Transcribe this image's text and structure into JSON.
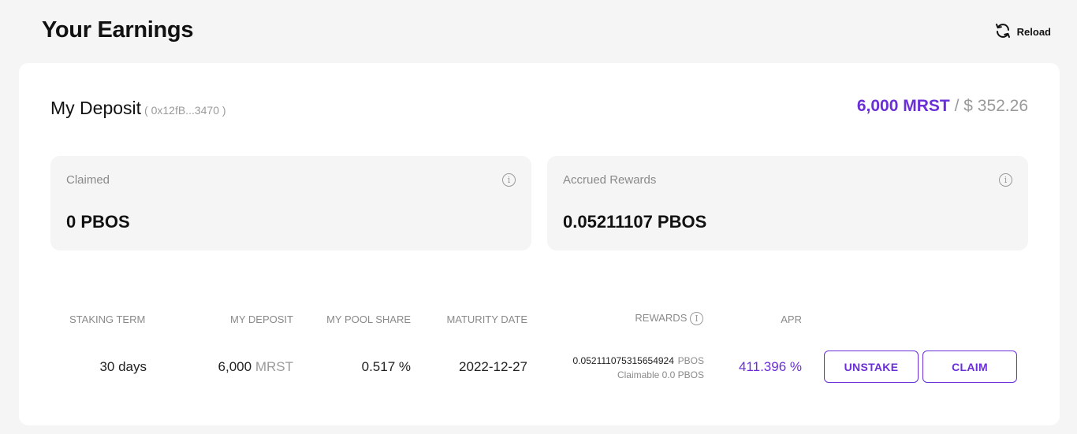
{
  "header": {
    "title": "Your Earnings",
    "reload_label": "Reload"
  },
  "deposit": {
    "heading": "My Deposit",
    "address": "( 0x12fB...3470 )",
    "amount": "6,000 MRST",
    "separator": " / ",
    "usd_value": "$ 352.26"
  },
  "stats": [
    {
      "label": "Claimed",
      "value": "0 PBOS"
    },
    {
      "label": "Accrued Rewards",
      "value": "0.05211107 PBOS"
    }
  ],
  "table": {
    "headers": {
      "staking_term": "STAKING TERM",
      "my_deposit": "MY DEPOSIT",
      "my_pool_share": "MY POOL SHARE",
      "maturity_date": "MATURITY DATE",
      "rewards": "REWARDS",
      "apr": "APR"
    },
    "row": {
      "staking_term": "30 days",
      "deposit_amount": "6,000",
      "deposit_token": "MRST",
      "pool_share": "0.517 %",
      "maturity_date": "2022-12-27",
      "rewards_amount": "0.052111075315654924",
      "rewards_token": "PBOS",
      "rewards_claimable": "Claimable 0.0 PBOS",
      "apr": "411.396 %",
      "unstake_label": "UNSTAKE",
      "claim_label": "CLAIM"
    }
  },
  "colors": {
    "accent": "#6a2fd6",
    "background": "#f5f5f5",
    "card": "#ffffff",
    "muted": "#9a9a9a"
  }
}
